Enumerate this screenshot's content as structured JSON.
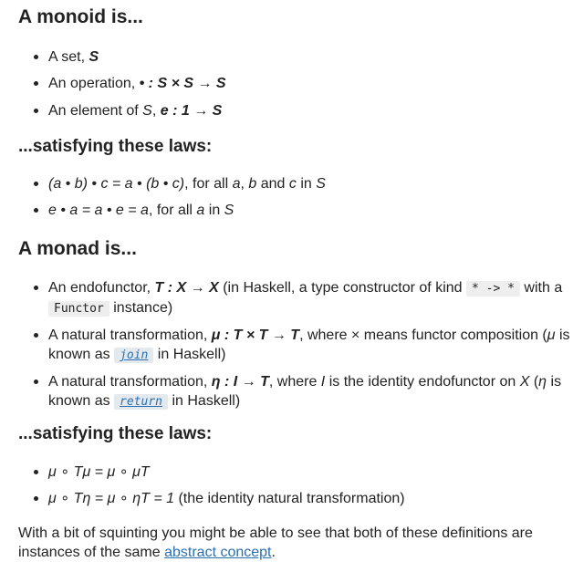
{
  "monoid": {
    "heading": "A monoid is...",
    "items": [
      {
        "prefix": "A set, ",
        "math": "S"
      },
      {
        "prefix": "An operation, ",
        "math": "• : S × S → S"
      },
      {
        "prefix": "An element of ",
        "m1": "S",
        "mid": ", ",
        "math": "e : 1 → S"
      }
    ],
    "laws_heading": "...satisfying these laws:",
    "laws": [
      {
        "math": "(a • b) • c = a • (b • c)",
        "t1": ", for all ",
        "a": "a",
        "t2": ", ",
        "b": "b",
        "t3": " and ",
        "c": "c",
        "t4": " in ",
        "s": "S"
      },
      {
        "math": "e • a = a • e = a",
        "t1": ", for all ",
        "a": "a",
        "t2": " in ",
        "s": "S"
      }
    ]
  },
  "monad": {
    "heading": "A monad is...",
    "items": [
      {
        "prefix": "An endofunctor, ",
        "math": "T : X → X",
        "t1": " (in Haskell, a type constructor of kind ",
        "code": "* -> *",
        "t2": " with a ",
        "code2": "Functor",
        "t3": " instance)"
      },
      {
        "prefix": "A natural transformation, ",
        "math": "μ : T × T → T",
        "t1": ", where × means functor composition (",
        "mu": "μ",
        "t2": " is known as ",
        "code": "join",
        "t3": " in Haskell)"
      },
      {
        "prefix": "A natural transformation, ",
        "math": "η : I → T",
        "t1": ", where ",
        "i": "I",
        "t2": " is the identity endofunctor on ",
        "x": "X",
        "t3": " (",
        "eta": "η",
        "t4": " is known as ",
        "code": "return",
        "t5": " in Haskell)"
      }
    ],
    "laws_heading": "...satisfying these laws:",
    "laws": [
      {
        "math": "μ ∘ Tμ = μ ∘ μT"
      },
      {
        "math": "μ ∘ Tη = μ ∘ ηT = 1",
        "t1": " (the identity natural transformation)"
      }
    ]
  },
  "footer": {
    "text": "With a bit of squinting you might be able to see that both of these definitions are instances of the same ",
    "link": "abstract concept",
    "end": "."
  }
}
